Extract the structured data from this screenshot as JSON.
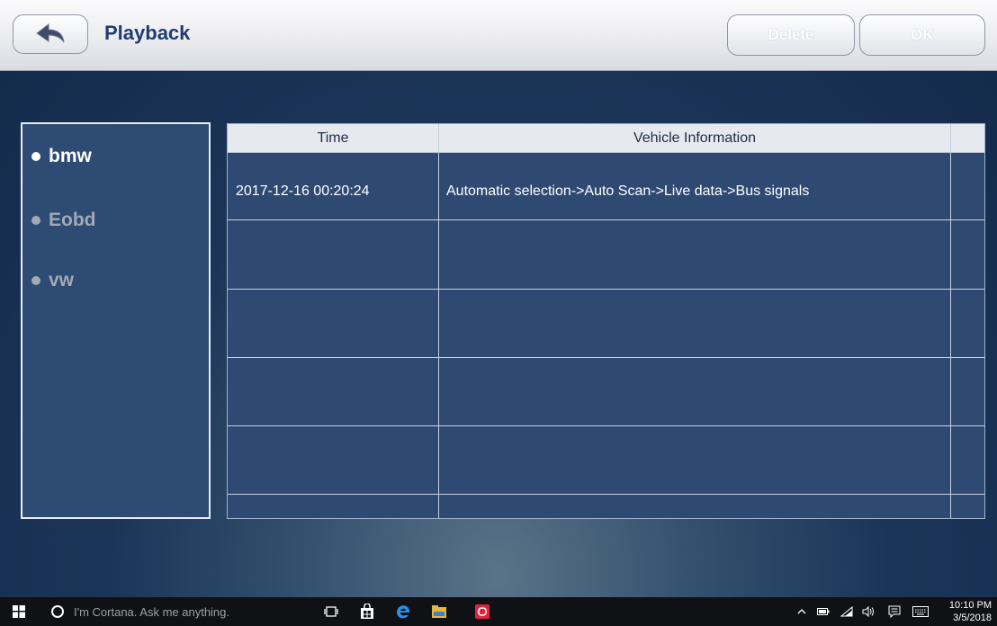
{
  "header": {
    "title": "Playback",
    "delete_label": "Delete",
    "ok_label": "OK"
  },
  "sidebar": {
    "items": [
      {
        "label": "bmw",
        "active": true
      },
      {
        "label": "Eobd",
        "active": false
      },
      {
        "label": "vw",
        "active": false
      }
    ]
  },
  "table": {
    "columns": [
      "Time",
      "Vehicle Information"
    ],
    "rows": [
      {
        "time": "2017-12-16 00:20:24",
        "info": "Automatic selection->Auto Scan->Live data->Bus signals"
      },
      {
        "time": "",
        "info": ""
      },
      {
        "time": "",
        "info": ""
      },
      {
        "time": "",
        "info": ""
      },
      {
        "time": "",
        "info": ""
      },
      {
        "time": "",
        "info": ""
      }
    ]
  },
  "taskbar": {
    "search_placeholder": "I'm Cortana. Ask me anything.",
    "time": "10:10 PM",
    "date": "3/5/2018"
  },
  "icons": {
    "back": "back-arrow-icon",
    "windows": "windows-start-icon",
    "cortana": "cortana-circle-icon",
    "task_view": "task-view-icon",
    "store": "store-icon",
    "edge": "edge-icon",
    "explorer": "file-explorer-icon",
    "app": "red-app-icon"
  },
  "colors": {
    "title": "#1f3c70",
    "background": "#1b3558",
    "panel": "#2d4b73",
    "table_header": "#e6e9ee"
  }
}
